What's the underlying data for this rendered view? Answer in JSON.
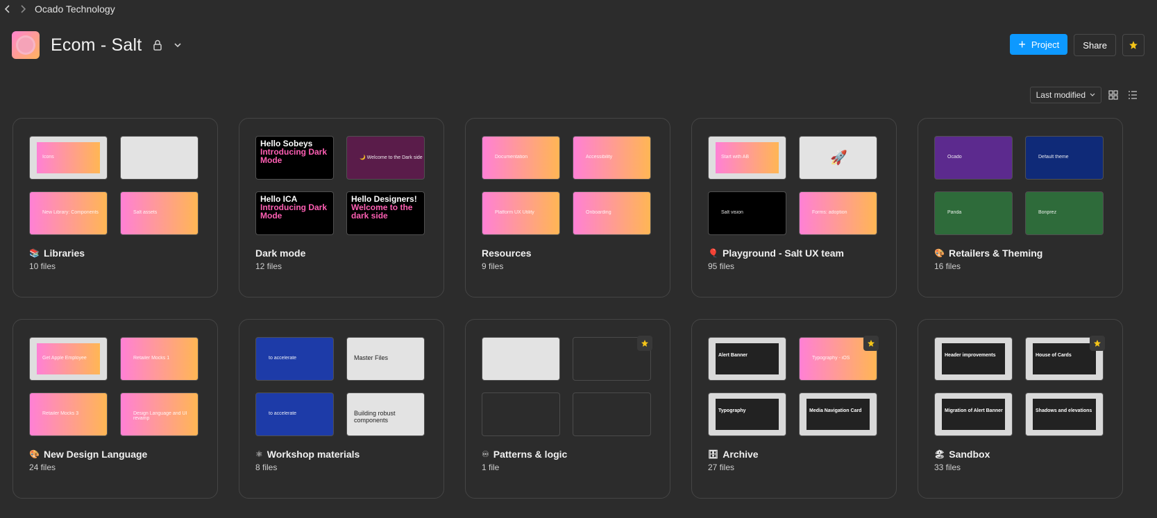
{
  "breadcrumb": "Ocado Technology",
  "project": {
    "title": "Ecom - Salt"
  },
  "buttons": {
    "project": "Project",
    "share": "Share"
  },
  "sort": {
    "label": "Last modified"
  },
  "colors": {
    "accent": "#0d99ff",
    "star": "#f5c518",
    "background": "#2c2c2c"
  },
  "cards": [
    {
      "title": "Libraries",
      "emoji": "📚",
      "count": "10 files",
      "starred": false,
      "thumbs": [
        {
          "style": "gray",
          "text": "Icons"
        },
        {
          "style": "light",
          "text": ""
        },
        {
          "style": "grad",
          "text": "New Library: Components"
        },
        {
          "style": "grad",
          "text": "Salt assets"
        }
      ]
    },
    {
      "title": "Dark mode",
      "emoji": "",
      "count": "12 files",
      "starred": false,
      "thumbs": [
        {
          "style": "black",
          "big1": "Hello Sobeys",
          "big2": "Introducing Dark Mode"
        },
        {
          "style": "maroon",
          "text": "🌙 Welcome to the Dark side"
        },
        {
          "style": "black",
          "big1": "Hello ICA",
          "big2": "Introducing Dark Mode"
        },
        {
          "style": "black",
          "big1": "Hello Designers!",
          "big2": "Welcome to the dark side"
        }
      ]
    },
    {
      "title": "Resources",
      "emoji": "",
      "count": "9 files",
      "starred": false,
      "thumbs": [
        {
          "style": "grad",
          "text": "Documentation"
        },
        {
          "style": "grad",
          "text": "Accessibility"
        },
        {
          "style": "grad",
          "text": "Platform UX Utility"
        },
        {
          "style": "grad",
          "text": "Onboarding"
        }
      ]
    },
    {
      "title": "Playground - Salt UX team",
      "emoji": "🎈",
      "count": "95 files",
      "starred": false,
      "thumbs": [
        {
          "style": "gray",
          "text": "Start with AB"
        },
        {
          "style": "light",
          "text": "🚀"
        },
        {
          "style": "black",
          "text": "Salt vision"
        },
        {
          "style": "grad",
          "text": "Forms: adoption"
        }
      ]
    },
    {
      "title": "Retailers & Theming",
      "emoji": "🎨",
      "count": "16 files",
      "starred": false,
      "thumbs": [
        {
          "style": "purple",
          "text": "Ocado"
        },
        {
          "style": "navy",
          "text": "Default theme"
        },
        {
          "style": "green",
          "text": "Panda"
        },
        {
          "style": "green",
          "text": "Bonprez"
        }
      ]
    },
    {
      "title": "New Design Language",
      "emoji": "🎨",
      "count": "24 files",
      "starred": false,
      "thumbs": [
        {
          "style": "gray",
          "text": "Get Apple Employee"
        },
        {
          "style": "grad",
          "text": "Retailer Mocks 1"
        },
        {
          "style": "grad",
          "text": "Retailer Mocks 3"
        },
        {
          "style": "grad",
          "text": "Design Language and UI revamp"
        }
      ]
    },
    {
      "title": "Workshop materials",
      "emoji": "⚛",
      "count": "8 files",
      "starred": false,
      "thumbs": [
        {
          "style": "blue",
          "text": "to accelerate"
        },
        {
          "style": "lighttxt",
          "text": "Master Files"
        },
        {
          "style": "blue",
          "text": "to accelerate"
        },
        {
          "style": "lighttxt",
          "text": "Building robust components"
        }
      ]
    },
    {
      "title": "Patterns & logic",
      "emoji": "♾",
      "count": "1 file",
      "starred": true,
      "thumbs": [
        {
          "style": "light",
          "text": ""
        },
        {
          "style": "empty",
          "text": ""
        },
        {
          "style": "empty",
          "text": ""
        },
        {
          "style": "empty",
          "text": ""
        }
      ]
    },
    {
      "title": "Archive",
      "emoji": "🗄",
      "count": "27 files",
      "starred": true,
      "thumbs": [
        {
          "style": "dark",
          "text": "Alert Banner"
        },
        {
          "style": "grad",
          "text": "Typography - iOS"
        },
        {
          "style": "dark",
          "text": "Typography"
        },
        {
          "style": "dark",
          "text": "Media Navigation Card"
        }
      ]
    },
    {
      "title": "Sandbox",
      "emoji": "🏖",
      "count": "33 files",
      "starred": true,
      "thumbs": [
        {
          "style": "dark",
          "text": "Header improvements"
        },
        {
          "style": "dark",
          "text": "House of Cards"
        },
        {
          "style": "dark",
          "text": "Migration of Alert Banner"
        },
        {
          "style": "dark",
          "text": "Shadows and elevations"
        }
      ]
    }
  ]
}
